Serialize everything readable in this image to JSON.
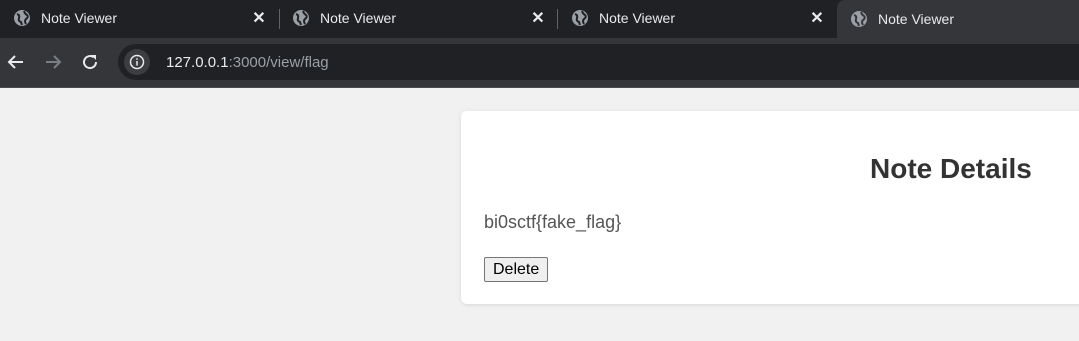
{
  "tabs": [
    {
      "title": "Note Viewer",
      "active": false
    },
    {
      "title": "Note Viewer",
      "active": false
    },
    {
      "title": "Note Viewer",
      "active": false
    },
    {
      "title": "Note Viewer",
      "active": true
    }
  ],
  "toolbar": {
    "url_host": "127.0.0.1",
    "url_rest": ":3000/view/flag"
  },
  "note": {
    "heading": "Note Details",
    "content": "bi0sctf{fake_flag}",
    "delete_label": "Delete"
  },
  "icons": [
    "globe-icon",
    "close-icon",
    "back-arrow-icon",
    "forward-arrow-icon",
    "reload-icon",
    "info-icon"
  ],
  "colors": {
    "tabstrip": "#202124",
    "toolbar": "#35363a",
    "page_bg": "#f1f1f1",
    "card_bg": "#ffffff",
    "heading": "#333333"
  }
}
